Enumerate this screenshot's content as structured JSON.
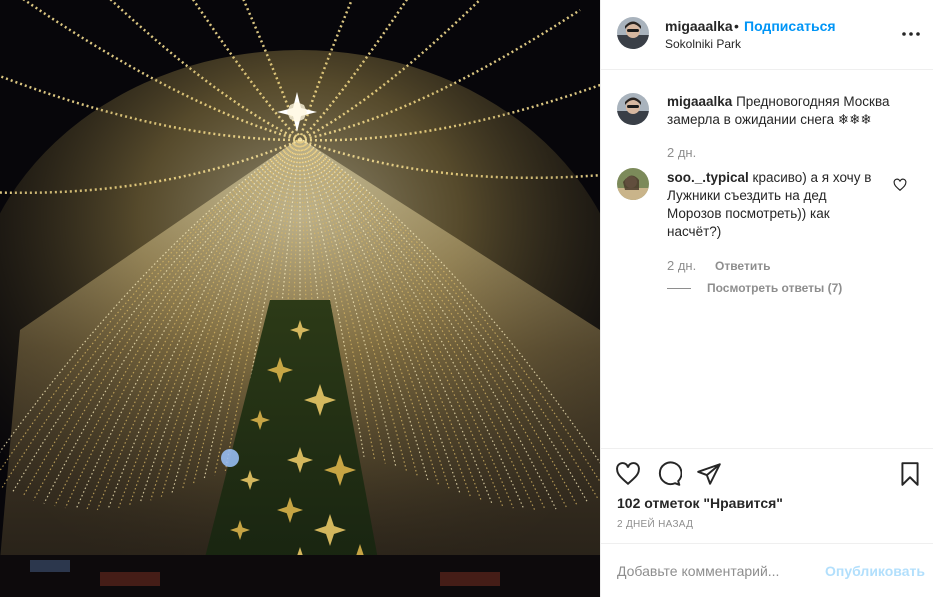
{
  "post": {
    "author": "migaaalka",
    "separator": "•",
    "follow_label": "Подписаться",
    "location": "Sokolniki Park",
    "more_icon": "more-horizontal-icon"
  },
  "caption": {
    "username": "migaaalka",
    "text": "Предновогодняя Москва замерла в ожидании снега ❄❄❄",
    "time": "2 дн."
  },
  "comments": [
    {
      "username": "soo._.typical",
      "text": "красиво) а я хочу в Лужники съездить на дед Морозов посмотреть)) как насчёт?)",
      "time": "2 дн.",
      "reply_label": "Ответить",
      "view_replies_label": "Посмотреть ответы (7)",
      "like_icon": "heart-outline-icon"
    }
  ],
  "actions": {
    "like_icon": "heart-outline-icon",
    "comment_icon": "comment-bubble-icon",
    "share_icon": "paper-plane-icon",
    "save_icon": "bookmark-icon"
  },
  "likes_text": "102 отметок \"Нравится\"",
  "date_text": "2 ДНЕЙ НАЗАД",
  "add_comment": {
    "placeholder": "Добавьте комментарий...",
    "publish_label": "Опубликовать"
  },
  "colors": {
    "link_blue": "#0095f6",
    "publish_disabled": "#b2dffc",
    "muted_text": "#8e8e8e",
    "main_text": "#262626",
    "divider": "#efefef"
  }
}
